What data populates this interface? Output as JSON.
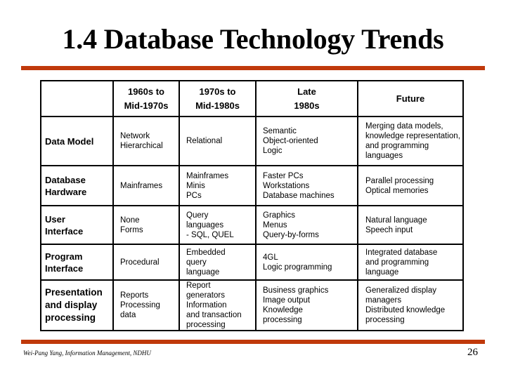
{
  "slide": {
    "title": "1.4 Database Technology Trends",
    "footer": "Wei-Pang Yang, Information Management, NDHU",
    "page_number": "26",
    "accent_color": "#c0390b"
  },
  "table": {
    "columns": [
      {
        "line1": "",
        "line2": ""
      },
      {
        "line1": "1960s to",
        "line2": "Mid-1970s"
      },
      {
        "line1": "1970s to",
        "line2": "Mid-1980s"
      },
      {
        "line1": "Late",
        "line2": "1980s"
      },
      {
        "line1": "Future",
        "line2": ""
      }
    ],
    "rows": [
      {
        "header": [
          "Data Model"
        ],
        "cells": [
          [
            "Network",
            "Hierarchical"
          ],
          [
            "Relational"
          ],
          [
            "Semantic",
            "Object-oriented",
            "Logic"
          ],
          [
            "Merging data models,",
            "knowledge representation,",
            "and programming",
            "languages"
          ]
        ]
      },
      {
        "header": [
          "Database",
          "Hardware"
        ],
        "cells": [
          [
            "Mainframes"
          ],
          [
            "Mainframes",
            "Minis",
            "PCs"
          ],
          [
            "Faster PCs",
            "Workstations",
            "Database machines"
          ],
          [
            "Parallel processing",
            "Optical memories"
          ]
        ]
      },
      {
        "header": [
          "User",
          "Interface"
        ],
        "cells": [
          [
            "None",
            "Forms"
          ],
          [
            "Query",
            "languages",
            "- SQL, QUEL"
          ],
          [
            "Graphics",
            "Menus",
            "Query-by-forms"
          ],
          [
            "Natural language",
            "Speech input"
          ]
        ]
      },
      {
        "header": [
          "Program",
          "Interface"
        ],
        "cells": [
          [
            "Procedural"
          ],
          [
            "Embedded",
            "query",
            "language"
          ],
          [
            "4GL",
            "Logic programming"
          ],
          [
            "Integrated database",
            "and programming",
            "language"
          ]
        ]
      },
      {
        "header": [
          "Presentation",
          "and display",
          "processing"
        ],
        "cells": [
          [
            "Reports",
            "Processing",
            "data"
          ],
          [
            "Report",
            "generators",
            "Information",
            "and transaction",
            "processing"
          ],
          [
            "Business graphics",
            "Image output",
            "Knowledge",
            "processing"
          ],
          [
            "Generalized display",
            "managers",
            "Distributed knowledge",
            "processing"
          ]
        ]
      }
    ]
  }
}
